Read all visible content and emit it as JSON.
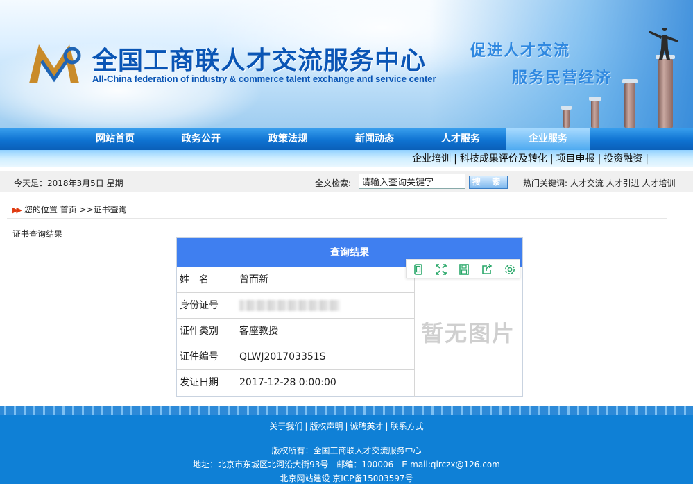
{
  "header": {
    "title": "全国工商联人才交流服务中心",
    "subtitle": "All-China federation of industry & commerce talent exchange and service center",
    "slogan_line1": "促进人才交流",
    "slogan_line2": "服务民营经济"
  },
  "nav": {
    "items": [
      "网站首页",
      "政务公开",
      "政策法规",
      "新闻动态",
      "人才服务",
      "企业服务"
    ],
    "active_index": 5
  },
  "subnav": {
    "items": [
      "企业培训",
      "科技成果评价及转化",
      "项目申报",
      "投资融资"
    ]
  },
  "infobar": {
    "today": "今天是：2018年3月5日 星期一",
    "search_label": "全文检索:",
    "search_value": "请输入查询关键字",
    "search_button": "搜 索",
    "hot_keywords": "热门关键词: 人才交流 人才引进 人才培训"
  },
  "breadcrumb": {
    "text": "您的位置 首页 >>证书查询"
  },
  "section_title": "证书查询结果",
  "result": {
    "heading": "查询结果",
    "rows": [
      {
        "label": "姓　名",
        "value": "曾而新"
      },
      {
        "label": "身份证号",
        "value": ""
      },
      {
        "label": "证件类别",
        "value": "客座教授"
      },
      {
        "label": "证件编号",
        "value": "QLWJ201703351S"
      },
      {
        "label": "发证日期",
        "value": "2017-12-28 0:00:00"
      }
    ],
    "no_image_text": "暂无图片"
  },
  "toolbar": {
    "icons": [
      "mobile-icon",
      "fullscreen-icon",
      "save-icon",
      "share-icon",
      "settings-icon"
    ],
    "color": "#2aa86a"
  },
  "footer": {
    "links": [
      "关于我们",
      "版权声明",
      "诚聘英才",
      "联系方式"
    ],
    "copyright": "版权所有：全国工商联人才交流服务中心",
    "address": "地址：北京市东城区北河沿大街93号　邮编：100006　E-mail:qlrczx@126.com",
    "icp": "北京网站建设 京ICP备15003597号"
  }
}
